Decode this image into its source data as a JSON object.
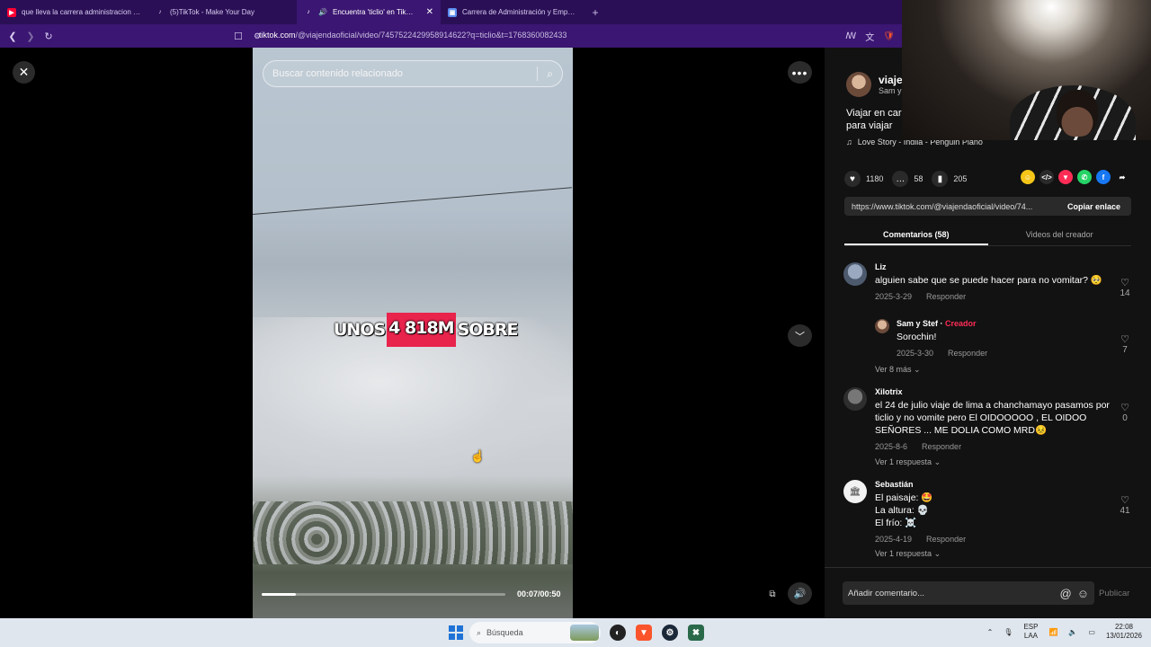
{
  "browser": {
    "tabs": [
      {
        "title": "que lleva la carrera administracion d...",
        "favicon": "youtube",
        "color": "#ff0033",
        "active": false,
        "glyph": "▶"
      },
      {
        "title": "(5)TikTok - Make Your Day",
        "favicon": "tiktok",
        "color": "#ffffff",
        "active": false,
        "glyph": "♪"
      },
      {
        "title": "Encuentra 'ticlio' en TikTok | B",
        "favicon": "tiktok",
        "color": "#ffffff",
        "active": true,
        "glyph": "♪"
      },
      {
        "title": "Carrera de Administración y Empren...",
        "favicon": "site",
        "color": "#5b8def",
        "active": false,
        "glyph": "▣"
      }
    ],
    "new_tab": "+",
    "url_domain": "tiktok.com",
    "url_path": "/@viajendaoficial/video/7457522429958914622?q=ticlio&t=1768360082433"
  },
  "video": {
    "search_placeholder": "Buscar contenido relacionado",
    "caption_before": "UNOS",
    "caption_highlight": "4 818M",
    "caption_after": "SOBRE",
    "time": "00:07/00:50",
    "progress": 0.14
  },
  "creator": {
    "name": "viaje",
    "subtitle": "Sam y",
    "description": "Viajar en car para viajar",
    "music": "Love Story - Indila - Penguin Piano"
  },
  "stats": {
    "likes": "1180",
    "comments": "58",
    "saves": "205"
  },
  "share": {
    "link": "https://www.tiktok.com/@viajendaoficial/video/74...",
    "copy_label": "Copiar enlace",
    "colors": [
      "#f5c518",
      "#2a2a2a",
      "#fe2c55",
      "#25d366",
      "#1877f2"
    ]
  },
  "panel_tabs": {
    "comments": "Comentarios (58)",
    "creator_videos": "Videos del creador"
  },
  "comments": [
    {
      "author": "Liz",
      "text": "alguien sabe que se puede hacer para no vomitar? 🥺",
      "date": "2025-3-29",
      "reply": "Responder",
      "likes": "14"
    },
    {
      "author": "Sam y Stef",
      "creator_tag": "Creador",
      "text": "Sorochin!",
      "date": "2025-3-30",
      "reply": "Responder",
      "likes": "7"
    },
    {
      "author": "Xilotrix",
      "text": "el 24 de julio viaje de lima a chanchamayo pasamos por ticlio y no vomite pero El OIDOOOOO , EL OIDOO SEÑORES ... ME DOLIA COMO MRD😣",
      "date": "2025-8-6",
      "reply": "Responder",
      "likes": "0"
    },
    {
      "author": "Sebastián",
      "text": "El paisaje: 🤩\nLa altura: 💀\nEl frío: ☠️",
      "date": "2025-4-19",
      "reply": "Responder",
      "likes": "41"
    }
  ],
  "more": {
    "ver_mas": "Ver 8 más",
    "ver_1": "Ver 1 respuesta",
    "ver_2": "Ver 1 respuesta"
  },
  "composer": {
    "placeholder": "Añadir comentario...",
    "publish": "Publicar"
  },
  "taskbar": {
    "search": "Búsqueda",
    "lang_1": "ESP",
    "lang_2": "LAA",
    "time": "22:08",
    "date": "13/01/2026"
  }
}
